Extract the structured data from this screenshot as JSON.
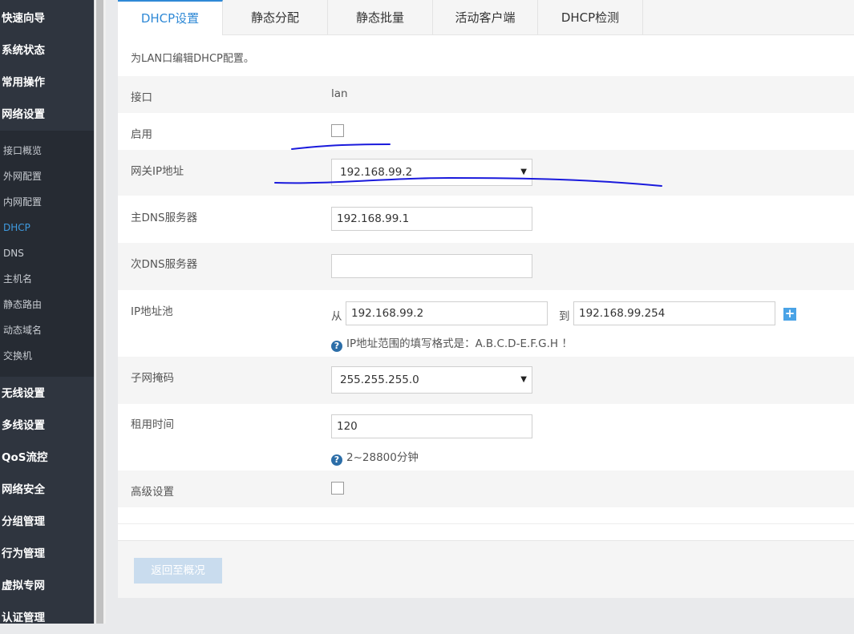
{
  "sidebar": {
    "menus_top": [
      "快速向导",
      "系统状态",
      "常用操作",
      "网络设置"
    ],
    "submenu": [
      "接口概览",
      "外网配置",
      "内网配置",
      "DHCP",
      "DNS",
      "主机名",
      "静态路由",
      "动态域名",
      "交换机"
    ],
    "active_submenu_index": 3,
    "menus_bottom": [
      "无线设置",
      "多线设置",
      "QoS流控",
      "网络安全",
      "分组管理",
      "行为管理",
      "虚拟专网",
      "认证管理"
    ]
  },
  "tabs": [
    "DHCP设置",
    "静态分配",
    "静态批量",
    "活动客户端",
    "DHCP检测"
  ],
  "active_tab": 0,
  "description": "为LAN口编辑DHCP配置。",
  "form": {
    "interface": {
      "label": "接口",
      "value": "lan"
    },
    "enable": {
      "label": "启用",
      "checked": false
    },
    "gateway": {
      "label": "网关IP地址",
      "value": "192.168.99.2"
    },
    "dns1": {
      "label": "主DNS服务器",
      "value": "192.168.99.1"
    },
    "dns2": {
      "label": "次DNS服务器",
      "value": ""
    },
    "pool": {
      "label": "IP地址池",
      "from_label": "从",
      "from_value": "192.168.99.2",
      "to_label": "到",
      "to_value": "192.168.99.254",
      "hint": "IP地址范围的填写格式是：A.B.C.D-E.F.G.H ！"
    },
    "subnet": {
      "label": "子网掩码",
      "value": "255.255.255.0"
    },
    "lease": {
      "label": "租用时间",
      "value": "120",
      "hint": "2~28800分钟"
    },
    "advanced": {
      "label": "高级设置",
      "checked": false
    }
  },
  "footer": {
    "back_label": "返回至概况"
  },
  "colors": {
    "sidebar": "#2f353f",
    "accent": "#2f89d6",
    "annotation": "#1a1adc"
  }
}
